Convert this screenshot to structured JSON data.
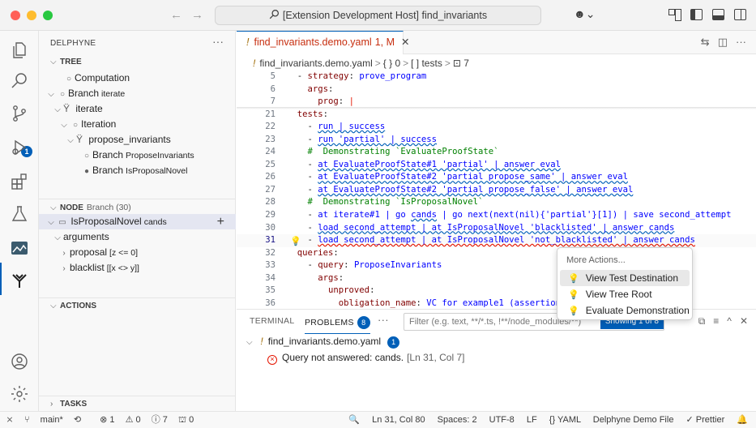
{
  "titlebar": {
    "title": "[Extension Development Host] find_invariants",
    "back_glyph": "←",
    "forward_glyph": "→",
    "accounts_glyph": "☻⌄",
    "icons": [
      "customize-layout-icon",
      "toggle-sidebar-icon",
      "toggle-panel-icon",
      "toggle-secondary-sidebar-icon"
    ]
  },
  "activitybar": {
    "items": [
      "explorer-icon",
      "search-icon",
      "source-control-icon",
      "run-debug-icon",
      "extensions-icon",
      "testing-icon",
      "chart-icon",
      "delphyne-icon",
      "accounts-icon",
      "manage-gear-icon"
    ],
    "scm_badge": "1"
  },
  "sidebar": {
    "title": "DELPHYNE",
    "more": "···",
    "tree_header": "TREE",
    "tree": [
      {
        "label": "Computation",
        "extra": ""
      },
      {
        "label": "Branch",
        "extra": "iterate"
      },
      {
        "label": "iterate",
        "extra": ""
      },
      {
        "label": "Iteration",
        "extra": ""
      },
      {
        "label": "propose_invariants",
        "extra": ""
      },
      {
        "label": "Branch",
        "extra": "ProposeInvariants"
      },
      {
        "label": "Branch",
        "extra": "IsProposalNovel"
      }
    ],
    "node_header": "NODE",
    "node_extra": "Branch (30)",
    "node_rows": [
      {
        "label": "IsProposalNovel",
        "extra": "cands"
      },
      {
        "label": "arguments",
        "extra": ""
      },
      {
        "label": "proposal",
        "extra": "[z <= 0]"
      },
      {
        "label": "blacklist",
        "extra": "[[x <> y]]"
      }
    ],
    "node_plus": "+",
    "actions_header": "ACTIONS",
    "tasks_header": "TASKS"
  },
  "editor": {
    "tab": {
      "excl": "!",
      "label": "find_invariants.demo.yaml",
      "meta": "1, M",
      "close": "✕"
    },
    "breadcrumb": {
      "excl": "!",
      "file": "find_invariants.demo.yaml",
      "sep": ">",
      "s1": "{ } 0",
      "s2": "[ ] tests",
      "s3": "⊡ 7"
    },
    "lines": [
      {
        "n": "5",
        "indent": "  ",
        "text": "- strategy: prove_program"
      },
      {
        "n": "6",
        "indent": "    ",
        "text": "args:"
      },
      {
        "n": "7",
        "indent": "      ",
        "text": "prog: |"
      },
      {
        "n": "21",
        "indent": "  ",
        "text": "tests:"
      },
      {
        "n": "22",
        "indent": "    ",
        "text": "- run | success"
      },
      {
        "n": "23",
        "indent": "    ",
        "text": "- run 'partial' | success"
      },
      {
        "n": "24",
        "indent": "    ",
        "text": "# Demonstrating `EvaluateProofState`"
      },
      {
        "n": "25",
        "indent": "    ",
        "text": "- at EvaluateProofState#1 'partial' | answer eval"
      },
      {
        "n": "26",
        "indent": "    ",
        "text": "- at EvaluateProofState#2 'partial propose_same' | answer eval"
      },
      {
        "n": "27",
        "indent": "    ",
        "text": "- at EvaluateProofState#2 'partial propose_false' | answer eval"
      },
      {
        "n": "28",
        "indent": "    ",
        "text": "# Demonstrating `IsProposalNovel`"
      },
      {
        "n": "29",
        "indent": "    ",
        "text": "- at iterate#1 | go cands | go next(next(nil){'partial'}[1]) | save second_attempt"
      },
      {
        "n": "30",
        "indent": "    ",
        "text": "- load second_attempt | at IsProposalNovel 'blacklisted' | answer cands"
      },
      {
        "n": "31",
        "indent": "    ",
        "text": "- load second_attempt | at IsProposalNovel 'not_blacklisted' | answer cands"
      },
      {
        "n": "32",
        "indent": "  ",
        "text": "queries:"
      },
      {
        "n": "33",
        "indent": "    ",
        "text": "- query: ProposeInvariants"
      },
      {
        "n": "34",
        "indent": "      ",
        "text": "args:"
      },
      {
        "n": "35",
        "indent": "        ",
        "text": "unproved:"
      },
      {
        "n": "36",
        "indent": "          ",
        "text": "obligation_name: VC for example1 (assertion"
      }
    ]
  },
  "panel": {
    "tab_terminal": "TERMINAL",
    "tab_problems": "PROBLEMS",
    "problems_count": "8",
    "more": "···",
    "filter_placeholder": "Filter (e.g. text, **/*.ts, !**/node_modules/**)",
    "showing": "Showing 1 of 8",
    "actions": [
      "⧉",
      "≡",
      "^",
      "✕"
    ],
    "file_row": {
      "excl": "!",
      "file": "find_invariants.demo.yaml",
      "count": "1"
    },
    "problem": {
      "message": "Query not answered: cands.",
      "location": "[Ln 31, Col 7]"
    }
  },
  "menu": {
    "title": "More Actions...",
    "items": [
      "View Test Destination",
      "View Tree Root",
      "Evaluate Demonstration"
    ]
  },
  "statusbar": {
    "remote": "⨯",
    "branch": "main*",
    "sync": "⟲",
    "errors": "⊗ 1",
    "warnings": "⚠ 0",
    "infos": "ⓘ 7",
    "ports": "⛫ 0",
    "zoom": "🔍",
    "position": "Ln 31, Col 80",
    "spaces": "Spaces: 2",
    "encoding": "UTF-8",
    "eol": "LF",
    "language": "{} YAML",
    "delphyne": "Delphyne Demo File",
    "prettier": "✓ Prettier",
    "bell": "🔔"
  },
  "colors": {
    "accent": "#005fb8",
    "error": "#e51400",
    "warning": "#9e6a03",
    "key": "#800000",
    "comment": "#008000"
  }
}
